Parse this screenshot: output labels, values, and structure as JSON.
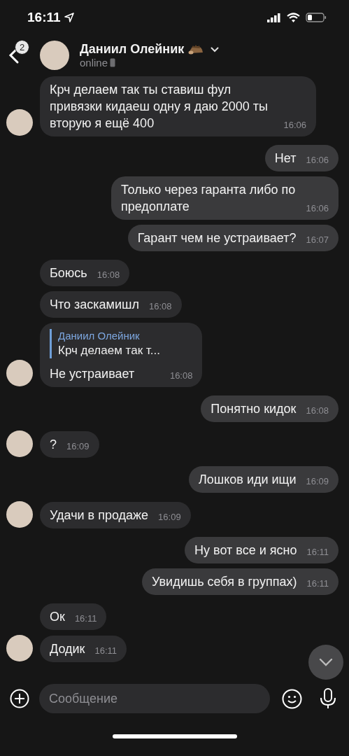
{
  "status_bar": {
    "time": "16:11"
  },
  "header": {
    "unread_badge": "2",
    "name": "Даниил Олейник",
    "status": "online"
  },
  "messages": [
    {
      "kind": "incoming",
      "text": "Крч делаем так ты ставиш фул привязки кидаеш одну я даю 2000 ты вторую я ещё 400",
      "time": "16:06",
      "avatar": true
    },
    {
      "kind": "outgoing",
      "text": "Нет",
      "time": "16:06"
    },
    {
      "kind": "outgoing",
      "text": "Только через гаранта либо по предоплате",
      "time": "16:06"
    },
    {
      "kind": "outgoing",
      "text": "Гарант чем не устраивает?",
      "time": "16:07"
    },
    {
      "kind": "incoming",
      "text": "Боюсь",
      "time": "16:08",
      "avatar": false
    },
    {
      "kind": "incoming",
      "text": "Что заскамишл",
      "time": "16:08",
      "avatar": false
    },
    {
      "kind": "incoming",
      "text": "Не устраивает",
      "time": "16:08",
      "avatar": true,
      "reply": {
        "author": "Даниил Олейник",
        "text": "Крч делаем так т..."
      }
    },
    {
      "kind": "outgoing",
      "text": "Понятно кидок",
      "time": "16:08"
    },
    {
      "kind": "incoming",
      "text": "?",
      "time": "16:09",
      "avatar": true
    },
    {
      "kind": "outgoing",
      "text": "Лошков иди ищи",
      "time": "16:09"
    },
    {
      "kind": "incoming",
      "text": "Удачи в продаже",
      "time": "16:09",
      "avatar": true
    },
    {
      "kind": "outgoing",
      "text": "Ну вот все и ясно",
      "time": "16:11"
    },
    {
      "kind": "outgoing",
      "text": "Увидишь себя в группах)",
      "time": "16:11"
    },
    {
      "kind": "incoming",
      "text": "Ок",
      "time": "16:11",
      "avatar": false
    },
    {
      "kind": "incoming",
      "text": "Додик",
      "time": "16:11",
      "avatar": true
    }
  ],
  "composer": {
    "placeholder": "Сообщение"
  }
}
